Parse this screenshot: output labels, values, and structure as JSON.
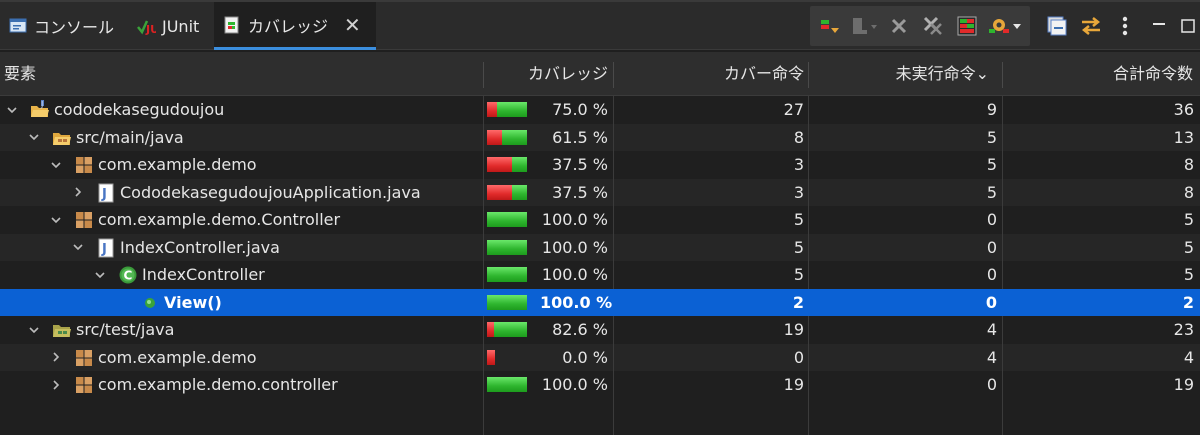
{
  "tabs": [
    {
      "label": "コンソール",
      "icon": "console-icon"
    },
    {
      "label": "JUnit",
      "icon": "junit-icon"
    },
    {
      "label": "カバレッジ",
      "icon": "coverage-icon",
      "active": true
    }
  ],
  "columns": [
    "要素",
    "カバレッジ",
    "カバー命令",
    "未実行命令",
    "合計命令数"
  ],
  "sort_indicator": "⌄",
  "rows": [
    {
      "level": 0,
      "expander": "open",
      "icon": "project-icon",
      "name": "cododekasegudoujou",
      "coverage": "75.0 %",
      "fraction": 0.75,
      "covered": "27",
      "missed": "9",
      "total": "36"
    },
    {
      "level": 1,
      "expander": "open",
      "icon": "source-folder-icon",
      "name": "src/main/java",
      "coverage": "61.5 %",
      "fraction": 0.615,
      "covered": "8",
      "missed": "5",
      "total": "13"
    },
    {
      "level": 2,
      "expander": "open",
      "icon": "package-icon",
      "name": "com.example.demo",
      "coverage": "37.5 %",
      "fraction": 0.375,
      "covered": "3",
      "missed": "5",
      "total": "8"
    },
    {
      "level": 3,
      "expander": "closed",
      "icon": "java-file-icon",
      "name": "CododekasegudoujouApplication.java",
      "coverage": "37.5 %",
      "fraction": 0.375,
      "covered": "3",
      "missed": "5",
      "total": "8"
    },
    {
      "level": 2,
      "expander": "open",
      "icon": "package-icon",
      "name": "com.example.demo.Controller",
      "coverage": "100.0 %",
      "fraction": 1.0,
      "covered": "5",
      "missed": "0",
      "total": "5"
    },
    {
      "level": 3,
      "expander": "open",
      "icon": "java-file-icon",
      "name": "IndexController.java",
      "coverage": "100.0 %",
      "fraction": 1.0,
      "covered": "5",
      "missed": "0",
      "total": "5"
    },
    {
      "level": 4,
      "expander": "open",
      "icon": "class-icon",
      "name": "IndexController",
      "coverage": "100.0 %",
      "fraction": 1.0,
      "covered": "5",
      "missed": "0",
      "total": "5"
    },
    {
      "level": 5,
      "expander": "none",
      "icon": "method-icon",
      "name": "View()",
      "coverage": "100.0 %",
      "fraction": 1.0,
      "covered": "2",
      "missed": "0",
      "total": "2",
      "selected": true
    },
    {
      "level": 1,
      "expander": "open",
      "icon": "test-folder-icon",
      "name": "src/test/java",
      "coverage": "82.6 %",
      "fraction": 0.826,
      "covered": "19",
      "missed": "4",
      "total": "23"
    },
    {
      "level": 2,
      "expander": "closed",
      "icon": "package-icon",
      "name": "com.example.demo",
      "coverage": "0.0 %",
      "fraction": 0.0,
      "covered": "0",
      "missed": "4",
      "total": "4"
    },
    {
      "level": 2,
      "expander": "closed",
      "icon": "package-icon",
      "name": "com.example.demo.controller",
      "coverage": "100.0 %",
      "fraction": 1.0,
      "covered": "19",
      "missed": "0",
      "total": "19"
    }
  ],
  "colors": {
    "selected": "#0b61d4",
    "covered": "#2eb52e",
    "missed": "#e12a2a",
    "tab_accent": "#3b8ede"
  }
}
